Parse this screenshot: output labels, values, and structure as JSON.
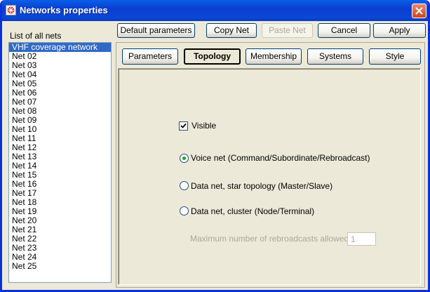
{
  "window": {
    "title": "Networks properties",
    "icon": "network-app-icon",
    "close_icon": "close-icon"
  },
  "list": {
    "label": "List of all nets",
    "selected_index": 0,
    "items": [
      "VHF coverage network",
      "Net 02",
      "Net 03",
      "Net 04",
      "Net 05",
      "Net 06",
      "Net 07",
      "Net 08",
      "Net 09",
      "Net 10",
      "Net 11",
      "Net 12",
      "Net 13",
      "Net 14",
      "Net 15",
      "Net 16",
      "Net 17",
      "Net 18",
      "Net 19",
      "Net 20",
      "Net 21",
      "Net 22",
      "Net 23",
      "Net 24",
      "Net 25"
    ]
  },
  "toolbar": {
    "default_params": "Default parameters",
    "copy_net": "Copy Net",
    "paste_net": "Paste Net",
    "paste_enabled": false,
    "cancel": "Cancel",
    "apply": "Apply"
  },
  "tabs": {
    "active": "Topology",
    "items": [
      "Parameters",
      "Topology",
      "Membership",
      "Systems",
      "Style"
    ]
  },
  "topology": {
    "visible_label": "Visible",
    "visible_checked": true,
    "selected_option": 0,
    "options": [
      "Voice net (Command/Subordinate/Rebroadcast)",
      "Data net, star topology (Master/Slave)",
      "Data net, cluster (Node/Terminal)"
    ],
    "max_rebroadcasts_label": "Maximum number of rebroadcasts allowed",
    "max_rebroadcasts_value": "1",
    "max_rebroadcasts_enabled": false
  },
  "colors": {
    "titlebar": "#0a46d6",
    "selection": "#316ac5",
    "dialog_bg": "#ece9d8",
    "radio_dot": "#21a121"
  }
}
